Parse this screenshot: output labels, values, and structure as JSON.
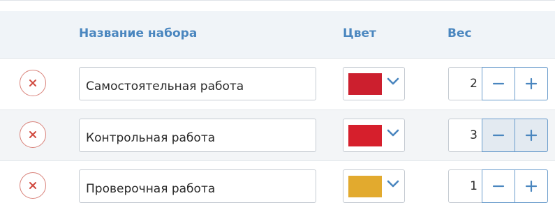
{
  "header": {
    "name_col": "Название набора",
    "color_col": "Цвет",
    "weight_col": "Вес"
  },
  "rows": [
    {
      "name": "Самостоятельная работа",
      "color": "#cc1f2e",
      "weight": "2"
    },
    {
      "name": "Контрольная работа",
      "color": "#d61f2c",
      "weight": "3"
    },
    {
      "name": "Проверочная работа",
      "color": "#e2aa2e",
      "weight": "1"
    }
  ],
  "icons": {
    "delete": "close-icon",
    "dropdown": "chevron-down-icon",
    "decrement": "minus-icon",
    "increment": "plus-icon"
  },
  "colors": {
    "accent": "#4a86bf",
    "delete_accent": "#d04a3f",
    "header_bg": "#f0f4f8"
  }
}
